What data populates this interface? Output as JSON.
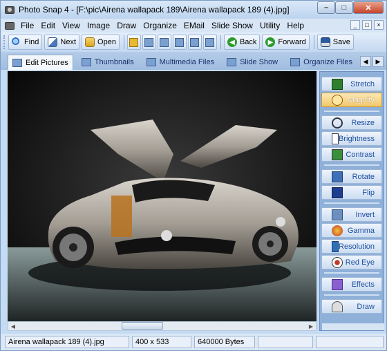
{
  "window": {
    "title": "Photo Snap 4 - [F:\\pic\\Airena wallapack 189\\Airena wallapack 189 (4).jpg]"
  },
  "window_controls": {
    "minimize": "–",
    "maximize": "□",
    "close": "✕"
  },
  "menu": [
    "File",
    "Edit",
    "View",
    "Image",
    "Draw",
    "Organize",
    "EMail",
    "Slide Show",
    "Utility",
    "Help"
  ],
  "mdi_controls": {
    "minimize": "_",
    "restore": "□",
    "close": "×"
  },
  "toolbar": {
    "find": "Find",
    "next": "Next",
    "open": "Open",
    "back": "Back",
    "forward": "Forward",
    "save": "Save"
  },
  "tabs": [
    "Edit Pictures",
    "Thumbnails",
    "Multimedia Files",
    "Slide Show",
    "Organize Files"
  ],
  "tab_nav": {
    "prev": "◀",
    "next": "▶"
  },
  "side_buttons": [
    "Stretch",
    "Magnify",
    "Resize",
    "Brightness",
    "Contrast",
    "Rotate",
    "Flip",
    "Invert",
    "Gamma",
    "Resolution",
    "Red Eye",
    "Effects",
    "Draw"
  ],
  "selected_side_button": "Magnify",
  "hscroll_arrows": {
    "left": "◀",
    "right": "▶"
  },
  "status": {
    "filename": "Airena wallapack 189 (4).jpg",
    "dimensions": "400 x 533",
    "size": "640000 Bytes"
  },
  "colors": {
    "accent": "#1f4fa0",
    "selected": "#f2c96b",
    "panel": "#8fb0d8"
  }
}
